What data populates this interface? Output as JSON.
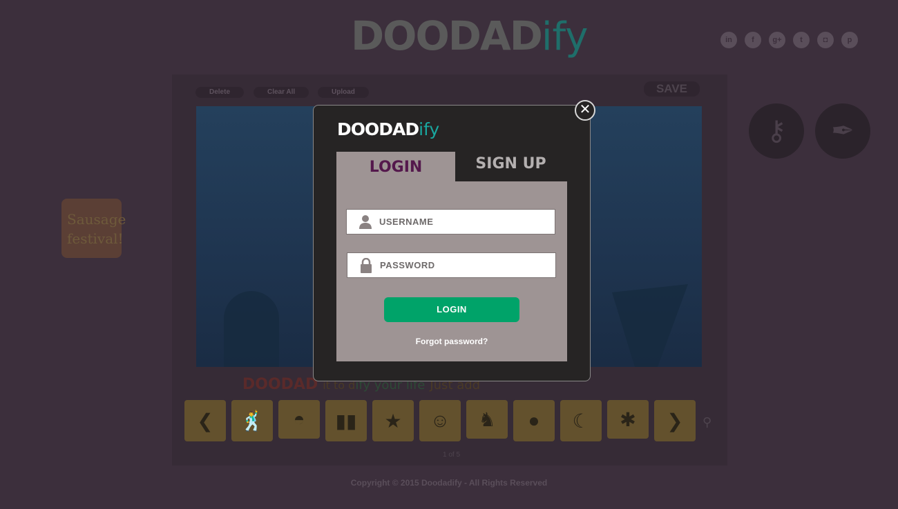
{
  "header": {
    "logo_main": "DOODAD",
    "logo_suffix": "ify",
    "social": [
      {
        "icon": "linkedin-icon",
        "glyph": "in"
      },
      {
        "icon": "facebook-icon",
        "glyph": "f"
      },
      {
        "icon": "google-plus-icon",
        "glyph": "g+"
      },
      {
        "icon": "twitter-icon",
        "glyph": "t"
      },
      {
        "icon": "instagram-icon",
        "glyph": "◘"
      },
      {
        "icon": "pinterest-icon",
        "glyph": "p"
      }
    ]
  },
  "toolbar": {
    "delete_label": "Delete",
    "clear_label": "Clear All",
    "upload_label": "Upload",
    "save_label": "SAVE"
  },
  "tagline": {
    "part1": "DOODAD",
    "part2": "it to d",
    "part3": "ify your life",
    "part4": "Just add"
  },
  "pager": "1 of 5",
  "note": {
    "text": "Sausage festival!"
  },
  "copyright": "Copyright © 2015 Doodadify - All Rights Reserved",
  "modal": {
    "logo_main": "DOODAD",
    "logo_suffix": "ify",
    "close_glyph": "✕",
    "tabs": {
      "login": "LOGIN",
      "signup": "SIGN UP"
    },
    "username_placeholder": "USERNAME",
    "password_placeholder": "PASSWORD",
    "login_button": "LOGIN",
    "forgot_link": "Forgot password?"
  },
  "colors": {
    "backdrop": "#3c2f3c",
    "login_button": "#00a369",
    "active_tab_text": "#54184c",
    "accent_ify": "#19a8a0"
  }
}
